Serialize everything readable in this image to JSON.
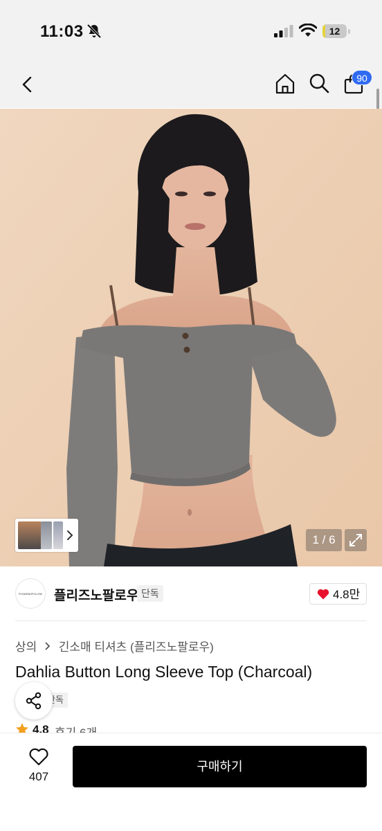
{
  "status_bar": {
    "time": "11:03",
    "battery_level": "12",
    "battery_fraction": 0.12,
    "battery_color": "#e6d23a",
    "icons": [
      "bell-slash-icon",
      "signal-icon",
      "wifi-icon",
      "battery-icon"
    ]
  },
  "header": {
    "icons": [
      "chevron-left-icon",
      "home-icon",
      "search-icon",
      "shopping-bag-icon"
    ],
    "cart_count": "90",
    "badge_color": "#2f6bf2"
  },
  "gallery": {
    "page_indicator": "1 / 6",
    "icons": [
      "chevron-right-icon",
      "expand-icon"
    ]
  },
  "brand": {
    "logo_text": "PLEASENOFOLLOW",
    "name": "플리즈노팔로우",
    "exclusive_tag": "단독",
    "like_count": "4.8만",
    "heart_color": "#e8112d"
  },
  "category": {
    "crumbs": [
      "상의",
      "긴소매 티셔츠 (플리즈노팔로우)"
    ]
  },
  "product": {
    "title": "Dahlia Button Long Sleeve Top (Charcoal)",
    "tag_partial": "단독",
    "rating": "4.8",
    "reviews": "후기 6개",
    "star_color": "#f3a01f"
  },
  "bottom_bar": {
    "wish_count": "407",
    "buy_label": "구매하기"
  }
}
